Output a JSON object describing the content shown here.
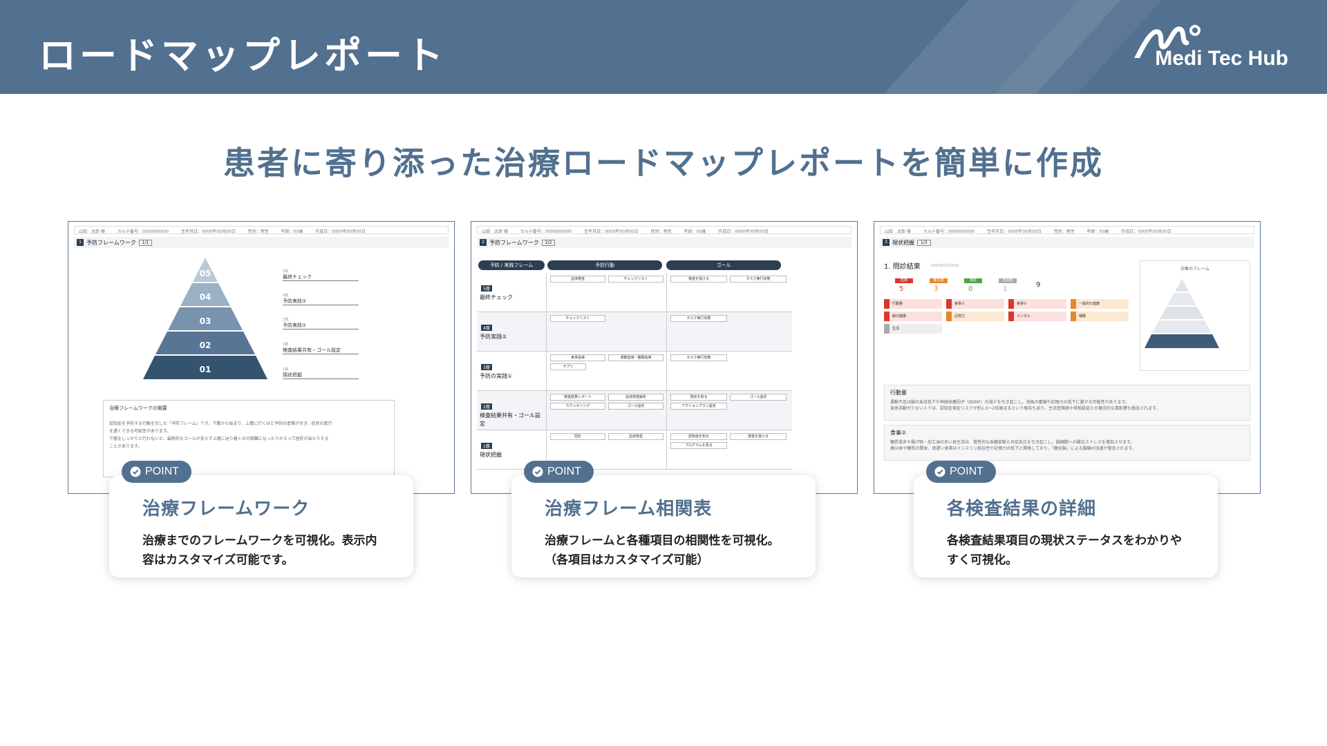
{
  "header": {
    "title": "ロードマップレポート",
    "logo_text": "Medi Tec Hub"
  },
  "heading": "患者に寄り添った治療ロードマップレポートを簡単に作成",
  "shot_common": {
    "header_line": "山田　太郎 様　　　カルテ番号：0000000000　　　生年月日：0000年00月00日　　　性別：男性　　　年齢：00歳　　　作成日：0000年00月00日"
  },
  "shot1": {
    "num": "1",
    "section": "予防フレームワーク",
    "page": "1/1",
    "levels": [
      "05",
      "04",
      "03",
      "02",
      "01"
    ],
    "rows": [
      {
        "step": "5層",
        "label": "最終チェック"
      },
      {
        "step": "4層",
        "label": "予防実践②"
      },
      {
        "step": "3層",
        "label": "予防実践①"
      },
      {
        "step": "2層",
        "label": "検査結果共有・ゴール設定"
      },
      {
        "step": "1層",
        "label": "現状把握"
      }
    ],
    "box_title": "治療フレームワークの概要",
    "box_lines": [
      "認知症を予防する行動を示した「予防フレーム」です。下層から始まり、上層に行くほど予防の習慣が付き、症状の進行",
      "を遅くできる可能性があります。",
      "下層をしっかりと行わないと、最終的なゴールが見えず上層に辿り着くのが困難になったりかえって挫折が出たりする",
      "ことがあります。"
    ]
  },
  "shot2": {
    "num": "2",
    "section": "予防フレームワーク",
    "page": "2/2",
    "pills": [
      "予防 / 実践フレーム",
      "予防行動",
      "ゴール"
    ],
    "rows": [
      {
        "tag": "5層",
        "label": "最終チェック",
        "chips": [
          "血液検査",
          "チェックリスト",
          "検査を受ける",
          "タスク実行状態"
        ]
      },
      {
        "tag": "4層",
        "label": "予防実践②",
        "chips": [
          "チェックリスト",
          "タスク実行状態"
        ]
      },
      {
        "tag": "3層",
        "label": "予防の実践①",
        "chips": [
          "食事指導",
          "運動指導・睡眠指導",
          "サプリ",
          "タスク実行状態"
        ]
      },
      {
        "tag": "2層",
        "label": "検査結果共有・ゴール設定",
        "chips": [
          "検査結果レポート",
          "血液検査解析",
          "カウンセリング",
          "ゴール設定",
          "現状を知る",
          "ゴール設定",
          "アクションプラン設定"
        ]
      },
      {
        "tag": "1層",
        "label": "現状把握",
        "chips": [
          "問診",
          "血液検査",
          "認知症を知る",
          "検査を受ける",
          "プログラムを見る"
        ]
      }
    ]
  },
  "shot3": {
    "num": "3",
    "section": "現状把握",
    "page": "1/3",
    "title": "1. 問診結果",
    "date": "0000年00月00日",
    "badges": [
      {
        "label": "危険",
        "count": "5",
        "color": "#d9382f"
      },
      {
        "label": "要注意",
        "count": "3",
        "color": "#e8862e"
      },
      {
        "label": "良好",
        "count": "0",
        "color": "#4ca64c"
      },
      {
        "label": "未回答",
        "count": "1",
        "color": "#aaaaaa"
      }
    ],
    "total": "9",
    "items": [
      {
        "label": "行動量",
        "color": "#d9382f"
      },
      {
        "label": "食事①",
        "color": "#d9382f"
      },
      {
        "label": "食事②",
        "color": "#d9382f"
      },
      {
        "label": "一般的な健康",
        "color": "#e8862e"
      },
      {
        "label": "脳の健康",
        "color": "#d9382f"
      },
      {
        "label": "記憶力",
        "color": "#e8862e"
      },
      {
        "label": "メンタル",
        "color": "#d9382f"
      },
      {
        "label": "睡眠",
        "color": "#e8862e"
      },
      {
        "label": "生活",
        "color": "#aaaaaa"
      }
    ],
    "frame_title": "対象のフレーム",
    "sections": [
      {
        "title": "行動量",
        "lines": [
          "運動不足は脳の血流低下や神経栄養因子（BDNF）の減少を引き起こし、海馬の萎縮や記憶力の低下に繋がる可能性があります。",
          "身体活動が少ない人では、認知症発症リスクが約1.5〜2倍高まるという報告もあり、生活習慣病や骨粗鬆症との複合的な悪影響も懸念されます。"
        ]
      },
      {
        "title": "食事②",
        "lines": [
          "糖質過多や揚げ物・加工油の多い食生活は、慢性的な血糖変動と炎症反応を引き起こし、脳細胞への酸化ストレスを増加させます。",
          "高GI食や糖質の間食、夜遅い食事はインスリン抵抗性や記憶力の低下と関係しており、「糖化脳」による脳機の加速が懸念されます。"
        ]
      }
    ]
  },
  "cards": [
    {
      "point": "POINT",
      "title": "治療フレームワーク",
      "desc": "治療までのフレームワークを可視化。表示内容はカスタマイズ可能です。"
    },
    {
      "point": "POINT",
      "title": "治療フレーム相関表",
      "desc": "治療フレームと各種項目の相関性を可視化。（各項目はカスタマイズ可能）"
    },
    {
      "point": "POINT",
      "title": "各検査結果の詳細",
      "desc": "各検査結果項目の現状ステータスをわかりやすく可視化。"
    }
  ],
  "colors": {
    "header": "#52708f",
    "navy": "#2c3e50",
    "accent": "#52708f"
  }
}
